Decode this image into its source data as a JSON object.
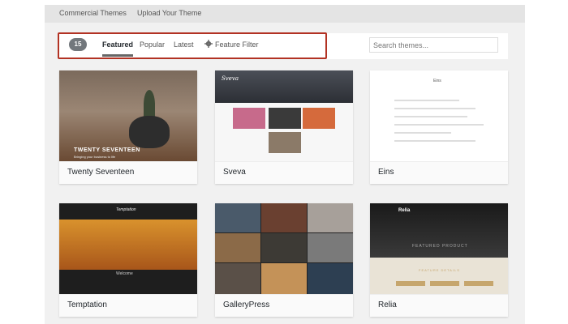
{
  "topbar": {
    "tabs": [
      "Commercial Themes",
      "Upload Your Theme"
    ]
  },
  "filter": {
    "count": "15",
    "tabs": [
      "Featured",
      "Popular",
      "Latest"
    ],
    "feature_filter": "Feature Filter",
    "search_placeholder": "Search themes..."
  },
  "themes": [
    {
      "name": "Twenty Seventeen",
      "shot_title": "TWENTY SEVENTEEN",
      "shot_sub": "Bringing your business to life"
    },
    {
      "name": "Sveva",
      "shot_title": "Sveva"
    },
    {
      "name": "Eins",
      "shot_title": "Eins"
    },
    {
      "name": "Temptation",
      "shot_title": "Temptation",
      "shot_sub": "Welcome"
    },
    {
      "name": "GalleryPress"
    },
    {
      "name": "Relia",
      "shot_title": "Relia",
      "shot_sub": "FEATURED PRODUCT",
      "shot_sub2": "FEATURE DETAILS"
    }
  ],
  "colors": {
    "accent": "#b23223",
    "badge": "#72777c"
  }
}
